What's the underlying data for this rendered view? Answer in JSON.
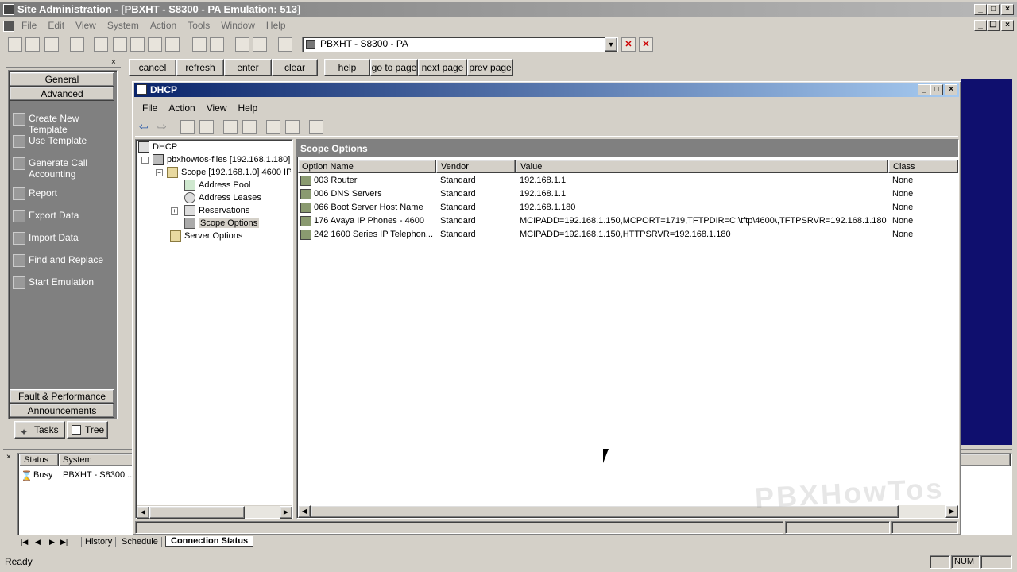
{
  "app": {
    "title": "Site Administration - [PBXHT - S8300 - PA Emulation: 513]"
  },
  "menu": [
    "File",
    "Edit",
    "View",
    "System",
    "Action",
    "Tools",
    "Window",
    "Help"
  ],
  "toolbar": {
    "connection": "PBXHT - S8300 - PA"
  },
  "commands": [
    "cancel",
    "refresh",
    "enter",
    "clear",
    "help",
    "go to page",
    "next page",
    "prev page"
  ],
  "sidebar": {
    "general": "General",
    "advanced": "Advanced",
    "tasks": [
      "Create New Template",
      "Use Template",
      "Generate Call Accounting",
      "Report",
      "Export Data",
      "Import Data",
      "Find and Replace",
      "Start Emulation"
    ],
    "fault": "Fault & Performance",
    "announcements": "Announcements",
    "tab_tasks": "Tasks",
    "tab_tree": "Tree"
  },
  "status_panel": {
    "col_status": "Status",
    "col_system": "System",
    "status": "Busy",
    "system": "PBXHT - S8300 ..."
  },
  "bottom_tabs": [
    "History",
    "Schedule",
    "Connection Status"
  ],
  "statusbar": {
    "text": "Ready",
    "num": "NUM"
  },
  "dhcp": {
    "title": "DHCP",
    "menu": [
      "File",
      "Action",
      "View",
      "Help"
    ],
    "tree": [
      "DHCP",
      "pbxhowtos-files [192.168.1.180]",
      "Scope [192.168.1.0] 4600 IP",
      "Address Pool",
      "Address Leases",
      "Reservations",
      "Scope Options",
      "Server Options"
    ],
    "panel_title": "Scope Options",
    "columns": [
      "Option Name",
      "Vendor",
      "Value",
      "Class"
    ],
    "rows": [
      {
        "name": "003 Router",
        "vendor": "Standard",
        "value": "192.168.1.1",
        "class": "None"
      },
      {
        "name": "006 DNS Servers",
        "vendor": "Standard",
        "value": "192.168.1.1",
        "class": "None"
      },
      {
        "name": "066 Boot Server Host Name",
        "vendor": "Standard",
        "value": "192.168.1.180",
        "class": "None"
      },
      {
        "name": "176 Avaya IP Phones - 4600",
        "vendor": "Standard",
        "value": "MCIPADD=192.168.1.150,MCPORT=1719,TFTPDIR=C:\\tftp\\4600\\,TFTPSRVR=192.168.1.180",
        "class": "None"
      },
      {
        "name": "242 1600 Series IP Telephon...",
        "vendor": "Standard",
        "value": "MCIPADD=192.168.1.150,HTTPSRVR=192.168.1.180",
        "class": "None"
      }
    ]
  },
  "watermark": "PBXHowTos"
}
